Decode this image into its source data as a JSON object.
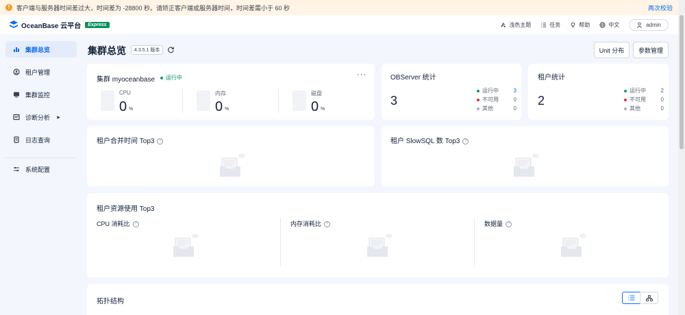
{
  "banner": {
    "message": "客户端与服务器时间差过大，时间差为 -28800 秒。请矫正客户端或服务器时间，时间差需小于 60 秒",
    "action": "再次校验"
  },
  "header": {
    "logo_text": "OceanBase 云平台",
    "badge": "Express",
    "items": [
      {
        "label": "浅色主题",
        "icon": "theme-icon"
      },
      {
        "label": "任务",
        "icon": "list-icon"
      },
      {
        "label": "帮助",
        "icon": "bulb-icon"
      },
      {
        "label": "中文",
        "icon": "globe-icon"
      }
    ],
    "user": "admin"
  },
  "sidebar": {
    "items": [
      {
        "label": "集群总览",
        "icon": "bar-chart-icon",
        "active": true
      },
      {
        "label": "租户管理",
        "icon": "tenant-icon"
      },
      {
        "label": "集群监控",
        "icon": "monitor-icon"
      },
      {
        "label": "诊断分析",
        "icon": "diagnosis-icon"
      },
      {
        "label": "日志查询",
        "icon": "log-icon"
      },
      {
        "label": "系统配置",
        "icon": "settings-sliders-icon"
      }
    ]
  },
  "page": {
    "title": "集群总览",
    "version": "4.3.5.1 版本",
    "buttons": {
      "unit": "Unit 分布",
      "params": "参数管理"
    }
  },
  "cluster": {
    "title": "集群 myoceanbase",
    "status": "运行中",
    "metrics": [
      {
        "label": "CPU",
        "value": "0",
        "unit": "%"
      },
      {
        "label": "内存",
        "value": "0",
        "unit": "%"
      },
      {
        "label": "磁盘",
        "value": "0",
        "unit": "%"
      }
    ]
  },
  "observer": {
    "title": "OBServer 统计",
    "total": "3",
    "legend": [
      {
        "label": "运行中",
        "value": "3",
        "color": "#0c9e63"
      },
      {
        "label": "不可用",
        "value": "0",
        "color": "#e0302e"
      },
      {
        "label": "其他",
        "value": "0",
        "color": "#a6adba"
      }
    ]
  },
  "tenants": {
    "title": "租户统计",
    "total": "2",
    "legend": [
      {
        "label": "运行中",
        "value": "2",
        "color": "#0c9e63"
      },
      {
        "label": "不可用",
        "value": "0",
        "color": "#e0302e"
      },
      {
        "label": "其他",
        "value": "0",
        "color": "#a6adba"
      }
    ]
  },
  "merge_top3": {
    "title": "租户合并时间 Top3"
  },
  "slowsql_top3": {
    "title": "租户 SlowSQL 数 Top3"
  },
  "resource_top3": {
    "title": "租户资源使用 Top3",
    "columns": [
      "CPU 消耗比",
      "内存消耗比",
      "数据量"
    ]
  },
  "topology": {
    "title": "拓扑结构"
  },
  "colors": {
    "primary": "#0d6cf2",
    "success": "#0c9e63",
    "danger": "#e0302e",
    "warning": "#f59a23"
  }
}
